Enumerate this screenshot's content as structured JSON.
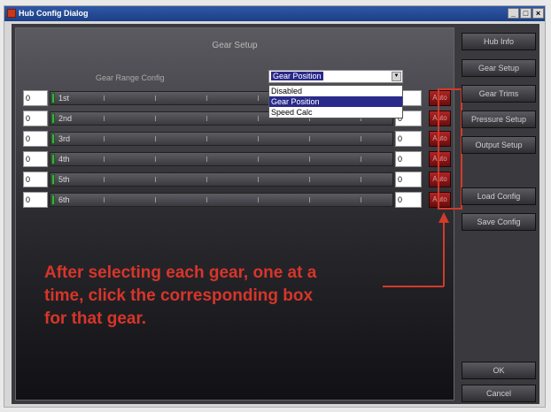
{
  "window": {
    "title": "Hub Config Dialog",
    "minimize_label": "_",
    "maximize_label": "□",
    "close_label": "×"
  },
  "panel": {
    "title": "Gear Setup",
    "range_label": "Gear Range Config",
    "select": {
      "value": "Gear Position",
      "options": [
        "Disabled",
        "Gear Position",
        "Speed Calc"
      ]
    }
  },
  "gears": [
    {
      "label": "1st",
      "left_value": "0",
      "right_value": "0",
      "auto_label": "Auto"
    },
    {
      "label": "2nd",
      "left_value": "0",
      "right_value": "0",
      "auto_label": "Auto"
    },
    {
      "label": "3rd",
      "left_value": "0",
      "right_value": "0",
      "auto_label": "Auto"
    },
    {
      "label": "4th",
      "left_value": "0",
      "right_value": "0",
      "auto_label": "Auto"
    },
    {
      "label": "5th",
      "left_value": "0",
      "right_value": "0",
      "auto_label": "Auto"
    },
    {
      "label": "6th",
      "left_value": "0",
      "right_value": "0",
      "auto_label": "Auto"
    }
  ],
  "annotation": {
    "line1": "After selecting each gear, one at a",
    "line2": "time, click the corresponding box",
    "line3": "for that gear."
  },
  "sidebar": {
    "hub_info": "Hub Info",
    "gear_setup": "Gear Setup",
    "gear_trims": "Gear Trims",
    "pressure_setup": "Pressure Setup",
    "output_setup": "Output Setup",
    "load_config": "Load Config",
    "save_config": "Save Config",
    "ok": "OK",
    "cancel": "Cancel"
  },
  "colors": {
    "annotation": "#d8352a",
    "auto_button": "#8a1616",
    "title_bar": "#2f58a6"
  }
}
